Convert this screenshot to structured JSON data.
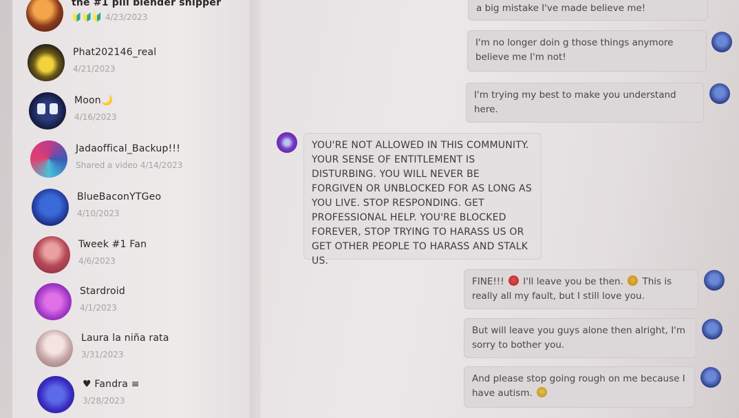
{
  "conversations": [
    {
      "name": "the #1 pill blender shipper",
      "badges": "🔰🔰🔰",
      "meta": "4/23/2023"
    },
    {
      "name": "Phat202146_real",
      "meta": "4/21/2023"
    },
    {
      "name": "Moon🌙",
      "meta": "4/16/2023"
    },
    {
      "name": "Jadaoffical_Backup!!!",
      "meta": "Shared a video 4/14/2023"
    },
    {
      "name": "BlueBaconYTGeo",
      "meta": "4/10/2023"
    },
    {
      "name": "Tweek #1 Fan",
      "meta": "4/6/2023"
    },
    {
      "name": "Stardroid",
      "meta": "4/1/2023"
    },
    {
      "name": "Laura la niña rata",
      "meta": "3/31/2023"
    },
    {
      "name": "♥ Fandra ≡",
      "meta": "3/28/2023"
    }
  ],
  "messages": {
    "m1": "a big mistake I've made believe me!",
    "m2": "I'm no longer doin g those things anymore believe me I'm not!",
    "m3": "I'm trying my best to make you understand here.",
    "m4": "YOU'RE NOT ALLOWED IN THIS COMMUNITY. YOUR SENSE OF ENTITLEMENT IS DISTURBING. YOU WILL NEVER BE FORGIVEN OR UNBLOCKED FOR AS LONG AS YOU LIVE. STOP RESPONDING. GET PROFESSIONAL HELP. YOU'RE BLOCKED FOREVER, STOP TRYING TO HARASS US OR GET OTHER PEOPLE TO HARASS AND STALK US.",
    "m5_a": "FINE!!!",
    "m5_b": "I'll leave you be then.",
    "m5_c": "This is really all my fault, but I still love you.",
    "m6": "But will leave you guys alone then alright, I'm sorry to bother you.",
    "m7": "And please stop going rough on me because I have autism."
  },
  "colors": {
    "bubble_outgoing": "#dcd7d8",
    "bubble_incoming": "#e4dfe0",
    "text_primary": "#2a2626",
    "text_muted": "#a8a2a3"
  }
}
